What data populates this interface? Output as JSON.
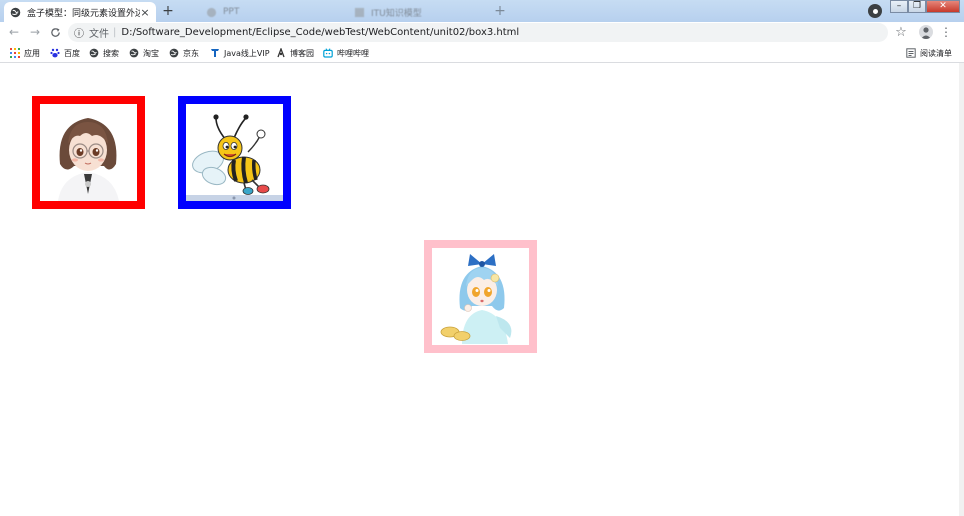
{
  "window": {
    "active_tab": {
      "title": "盒子模型：同级元素设置外边距",
      "close": "×"
    },
    "background_tabs": [
      {
        "title": "PPT"
      },
      {
        "title": "ITU知识模型"
      }
    ],
    "new_tab_label": "+",
    "controls": {
      "minimize": "–",
      "restore": "❐",
      "close": "✕"
    }
  },
  "toolbar": {
    "back": "←",
    "forward": "→",
    "reload": "C",
    "info_icon": "ⓘ",
    "scheme_label": "文件",
    "separator": "|",
    "url": "D:/Software_Development/Eclipse_Code/webTest/WebContent/unit02/box3.html",
    "star": "☆",
    "menu": "⋮"
  },
  "bookmarks": {
    "items": [
      {
        "label": "应用",
        "icon": "apps-grid-icon"
      },
      {
        "label": "百度",
        "icon": "baidu-paw-icon"
      },
      {
        "label": "搜索",
        "icon": "globe-icon"
      },
      {
        "label": "淘宝",
        "icon": "globe-icon"
      },
      {
        "label": "京东",
        "icon": "globe-icon"
      },
      {
        "label": "Java线上VIP",
        "icon": "java-t-icon"
      },
      {
        "label": "博客园",
        "icon": "cnblogs-icon"
      },
      {
        "label": "哔哩哔哩",
        "icon": "bilibili-icon"
      }
    ],
    "reading_list": {
      "label": "阅读清单",
      "icon": "reading-list-icon"
    }
  },
  "page": {
    "boxes": [
      {
        "name": "red-box",
        "border_color": "#ff0000",
        "image": "girl-avatar"
      },
      {
        "name": "blue-box",
        "border_color": "#0000ff",
        "image": "bee-cartoon"
      },
      {
        "name": "pink-box",
        "border_color": "#ffc0cb",
        "image": "anime-child"
      }
    ]
  }
}
